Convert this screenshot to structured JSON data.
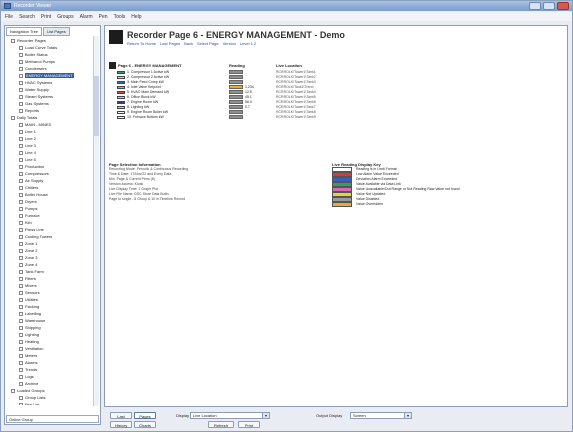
{
  "window": {
    "title": "Recorder Viewer"
  },
  "menu": [
    "File",
    "Search",
    "Print",
    "Groups",
    "Alarm",
    "Pen",
    "Tools",
    "Help"
  ],
  "left_panel": {
    "tabs": [
      "Navigation Tree",
      "List Pages"
    ],
    "status": "Online Group"
  },
  "tree": [
    {
      "label": "Recorder Pages",
      "selected": false
    },
    {
      "label": "Load Curve Totals",
      "selected": false
    },
    {
      "label": "Boiler Status",
      "selected": false
    },
    {
      "label": "Methanol Pumps",
      "selected": false
    },
    {
      "label": "Condensers",
      "selected": false
    },
    {
      "label": "ENERGY MANAGEMENT",
      "selected": true
    },
    {
      "label": "HVAC Systems",
      "selected": false
    },
    {
      "label": "Water Supply",
      "selected": false
    },
    {
      "label": "Steam Systems",
      "selected": false
    },
    {
      "label": "Gas Systems",
      "selected": false
    },
    {
      "label": "Reports",
      "selected": false
    },
    {
      "label": "Daily Totals",
      "selected": false
    },
    {
      "label": "MAIN - MINES",
      "selected": false
    },
    {
      "label": "Line 1",
      "selected": false
    },
    {
      "label": "Line 2",
      "selected": false
    },
    {
      "label": "Line 3",
      "selected": false
    },
    {
      "label": "Line 4",
      "selected": false
    },
    {
      "label": "Line 5",
      "selected": false
    },
    {
      "label": "Production",
      "selected": false
    },
    {
      "label": "Compressors",
      "selected": false
    },
    {
      "label": "Air Supply",
      "selected": false
    },
    {
      "label": "Chillers",
      "selected": false
    },
    {
      "label": "Boiler House",
      "selected": false
    },
    {
      "label": "Dryers",
      "selected": false
    },
    {
      "label": "Pumps",
      "selected": false
    },
    {
      "label": "Furnace",
      "selected": false
    },
    {
      "label": "Kiln",
      "selected": false
    },
    {
      "label": "Press Line",
      "selected": false
    },
    {
      "label": "Cooling Towers",
      "selected": false
    },
    {
      "label": "Zone 1",
      "selected": false
    },
    {
      "label": "Zone 2",
      "selected": false
    },
    {
      "label": "Zone 3",
      "selected": false
    },
    {
      "label": "Zone 4",
      "selected": false
    },
    {
      "label": "Tank Farm",
      "selected": false
    },
    {
      "label": "Filters",
      "selected": false
    },
    {
      "label": "Mixers",
      "selected": false
    },
    {
      "label": "Sensors",
      "selected": false
    },
    {
      "label": "Utilities",
      "selected": false
    },
    {
      "label": "Packing",
      "selected": false
    },
    {
      "label": "Labelling",
      "selected": false
    },
    {
      "label": "Warehouse",
      "selected": false
    },
    {
      "label": "Shipping",
      "selected": false
    },
    {
      "label": "Lighting",
      "selected": false
    },
    {
      "label": "Heating",
      "selected": false
    },
    {
      "label": "Ventilation",
      "selected": false
    },
    {
      "label": "Meters",
      "selected": false
    },
    {
      "label": "Alarms",
      "selected": false
    },
    {
      "label": "Trends",
      "selected": false
    },
    {
      "label": "Logs",
      "selected": false
    },
    {
      "label": "Archive",
      "selected": false
    },
    {
      "label": "Loaded Groups",
      "selected": false
    },
    {
      "label": "Group Lists",
      "selected": false
    },
    {
      "label": "Pen List",
      "selected": false
    }
  ],
  "page": {
    "title": "Recorder Page 6 - ENERGY  MANAGEMENT - Demo",
    "links": [
      "Return To Home",
      "Last Pages",
      "Back",
      "Select Page",
      "Version",
      "Level 1.2"
    ],
    "section_heading": "Page 6 - ENERGY  MANAGEMENT",
    "col_reading": "Reading",
    "col_location": "Live Location",
    "points": [
      {
        "label": "1. Compressor 1 Active kW",
        "color": "#2aa06a",
        "value": "",
        "location": "RCRROLK\\Tower1\\Tank1"
      },
      {
        "label": "2. Compressor 2 Active kW",
        "color": "#d5dee2",
        "value": "",
        "location": "RCRROLK\\Tower1\\Tank2"
      },
      {
        "label": "3. Main Feed Comp kW",
        "color": "#3e6cc4",
        "value": "",
        "location": "RCRROLK\\Tower1\\Tank3"
      },
      {
        "label": "4. Inlet Valve Setpoint",
        "color": "#e8a93a",
        "value": "1,234",
        "location": "RCRROLK\\Tank1\\Trend"
      },
      {
        "label": "5. HVAC Main Demand kW",
        "color": "#d44a3c",
        "value": "12.5",
        "location": "RCRROLK\\Tower1\\Tank4"
      },
      {
        "label": "6. Office Block kW",
        "color": "#e2e22a",
        "value": "45.1",
        "location": "RCRROLK\\Tower1\\Tank5"
      },
      {
        "label": "7. Engine Room kW",
        "color": "#2f3f99",
        "value": "56.0",
        "location": "RCRROLK\\Tower1\\Tank6"
      },
      {
        "label": "8. Lighting kW",
        "color": "#a7d8e6",
        "value": "0.7",
        "location": "RCRROLK\\Tower1\\Tank7"
      },
      {
        "label": "9. Engine Room Boiler kW",
        "color": "#f2f2f2",
        "value": "",
        "location": "RCRROLK\\Tower1\\Tank8"
      },
      {
        "label": "10. Furnace Bottom kW",
        "color": "#f2f2f2",
        "value": "",
        "location": "RCRROLK\\Tower1\\Tank9"
      }
    ],
    "info_title": "Page Selection Information",
    "info_lines": [
      "Recording Mode: Periodic & Continuous Recording",
      "Time & Date: 17/Nov/22 and Every Data",
      "Min. Page & Current Pens (8)",
      "Version Access: Kiosk",
      "Live Display Time: 1 Graph Plot",
      "Live File Name: DSC Store Data Buttn",
      "Page to single - 8 Group & 10 in Timeline Record"
    ],
    "legend_title": "Live Reading Display Key",
    "legend": [
      {
        "color": "#ffffff",
        "text": "Reading is in Limit Format"
      },
      {
        "color": "#d23c3c",
        "text": "Low Alarm Value Exceeded"
      },
      {
        "color": "#3b5fbf",
        "text": "Deviation Alarm Exceeded"
      },
      {
        "color": "#2aa06a",
        "text": "Value Available via Data Link"
      },
      {
        "color": "#d96ab4",
        "text": "Value Unavailable/Out Range or Not Reading Raw Value not found"
      },
      {
        "color": "#e0d43a",
        "text": "Value Not Updated"
      },
      {
        "color": "#9a9a9a",
        "text": "Value Disabled"
      },
      {
        "color": "#e8a93a",
        "text": "Value Overridden"
      }
    ]
  },
  "bottom": {
    "btn_last": "Last",
    "btn_pages": "Pages",
    "btn_history": "History",
    "btn_charts": "Charts",
    "label_display": "Display",
    "display_value": "Live Location",
    "btn_refresh": "Refresh",
    "btn_print": "Print",
    "label_output": "Output Display",
    "output_value": "Screen"
  }
}
